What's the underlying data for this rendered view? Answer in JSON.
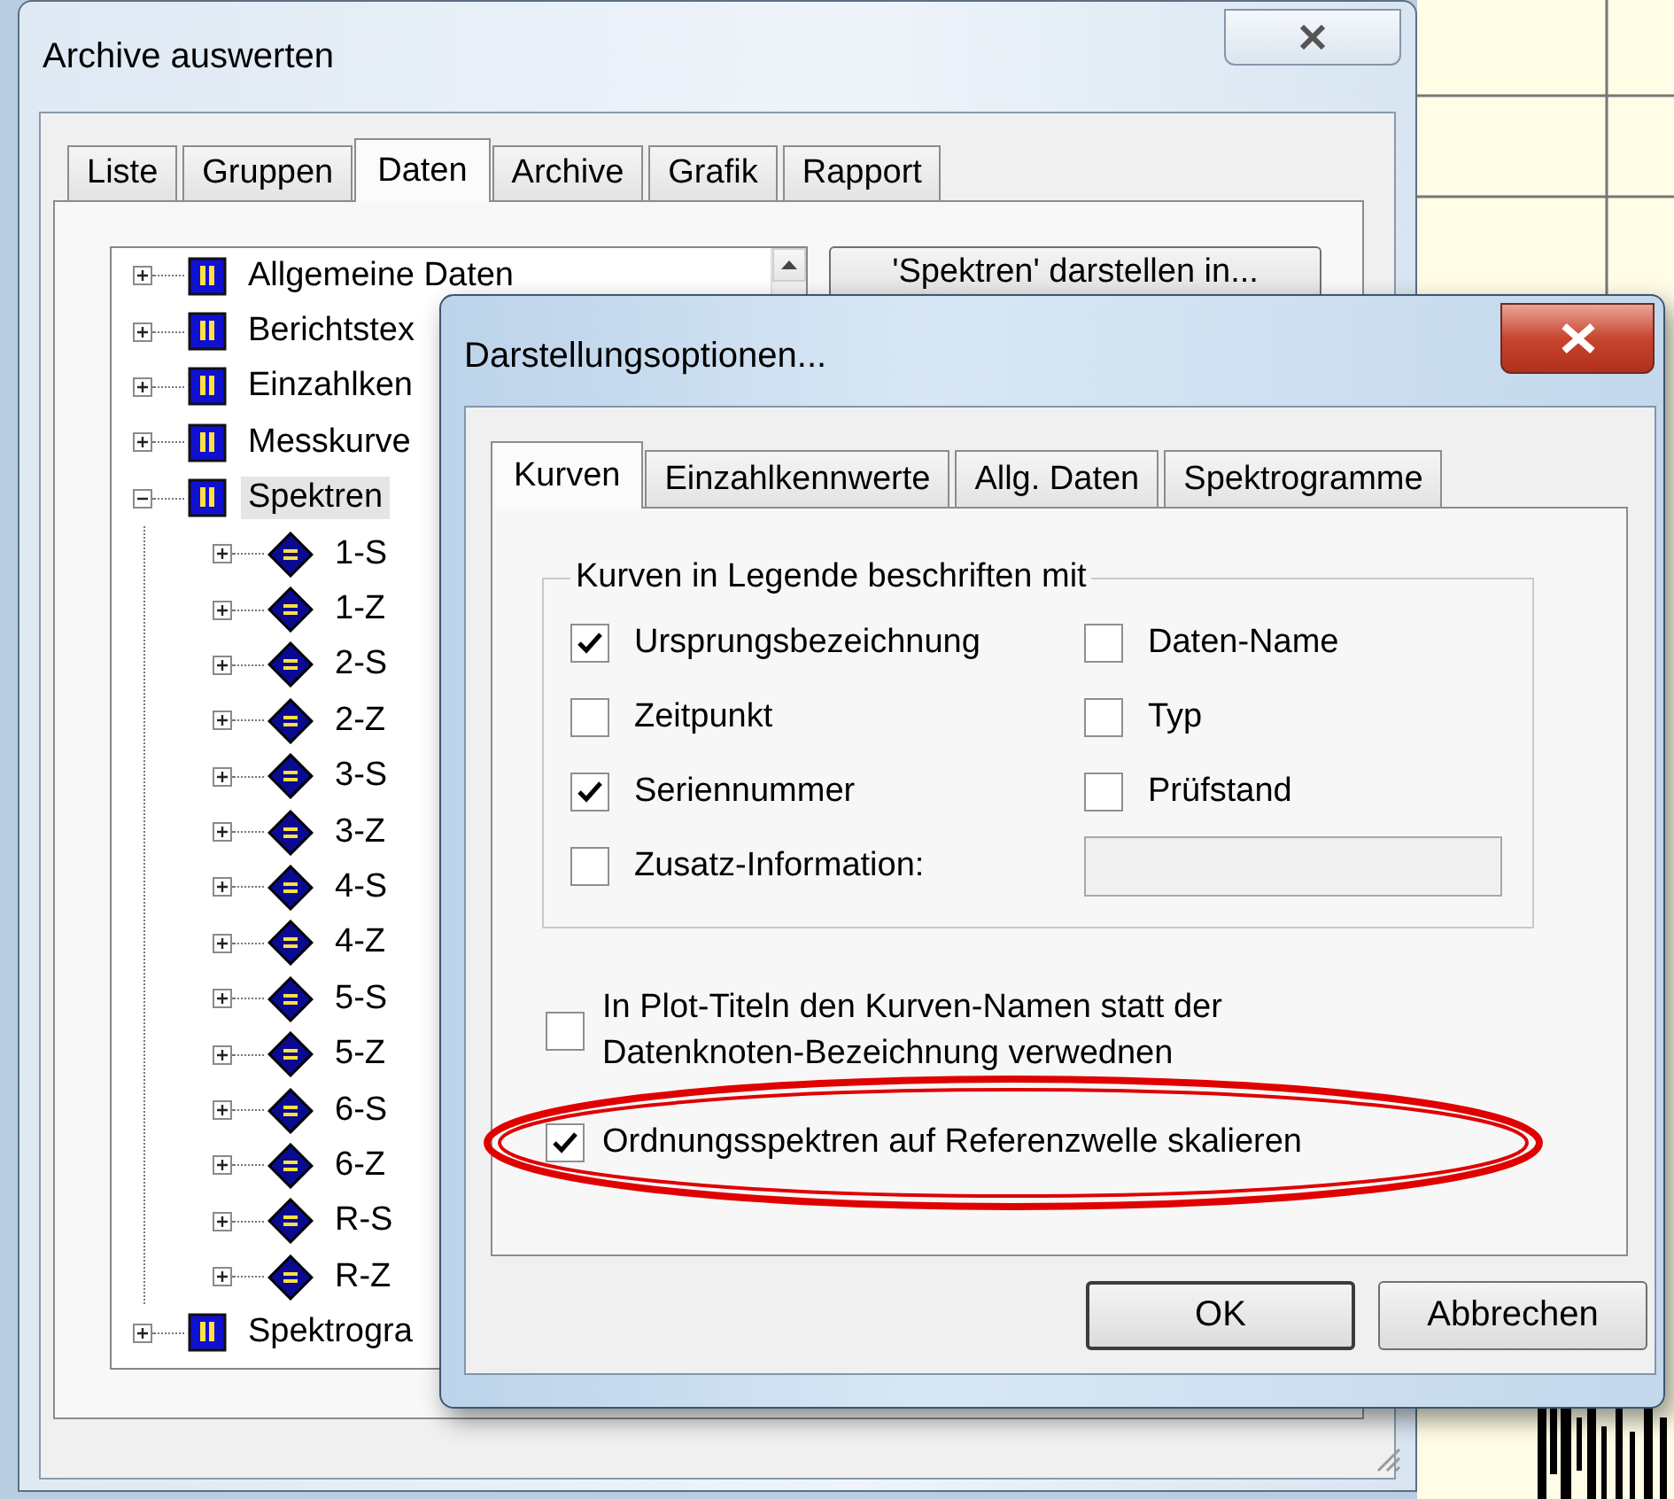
{
  "main_window": {
    "title": "Archive auswerten",
    "tabs": [
      {
        "label": "Liste",
        "selected": false
      },
      {
        "label": "Gruppen",
        "selected": false
      },
      {
        "label": "Daten",
        "selected": true
      },
      {
        "label": "Archive",
        "selected": false
      },
      {
        "label": "Grafik",
        "selected": false
      },
      {
        "label": "Rapport",
        "selected": false
      }
    ],
    "tree": [
      {
        "label": "Allgemeine Daten",
        "kind": "group",
        "expanded": false,
        "selected": false
      },
      {
        "label": "Berichtstex",
        "kind": "group",
        "expanded": false,
        "selected": false
      },
      {
        "label": "Einzahlken",
        "kind": "group",
        "expanded": false,
        "selected": false
      },
      {
        "label": "Messkurve",
        "kind": "group",
        "expanded": false,
        "selected": false
      },
      {
        "label": "Spektren",
        "kind": "group",
        "expanded": true,
        "selected": true,
        "children": [
          {
            "label": "1-S",
            "kind": "series",
            "expanded": false,
            "selected": false
          },
          {
            "label": "1-Z",
            "kind": "series",
            "expanded": false,
            "selected": false
          },
          {
            "label": "2-S",
            "kind": "series",
            "expanded": false,
            "selected": false
          },
          {
            "label": "2-Z",
            "kind": "series",
            "expanded": false,
            "selected": false
          },
          {
            "label": "3-S",
            "kind": "series",
            "expanded": false,
            "selected": false
          },
          {
            "label": "3-Z",
            "kind": "series",
            "expanded": false,
            "selected": false
          },
          {
            "label": "4-S",
            "kind": "series",
            "expanded": false,
            "selected": false
          },
          {
            "label": "4-Z",
            "kind": "series",
            "expanded": false,
            "selected": false
          },
          {
            "label": "5-S",
            "kind": "series",
            "expanded": false,
            "selected": false
          },
          {
            "label": "5-Z",
            "kind": "series",
            "expanded": false,
            "selected": false
          },
          {
            "label": "6-S",
            "kind": "series",
            "expanded": false,
            "selected": false
          },
          {
            "label": "6-Z",
            "kind": "series",
            "expanded": false,
            "selected": false
          },
          {
            "label": "R-S",
            "kind": "series",
            "expanded": false,
            "selected": false
          },
          {
            "label": "R-Z",
            "kind": "series",
            "expanded": false,
            "selected": false
          }
        ]
      },
      {
        "label": "Spektrogra",
        "kind": "group",
        "expanded": false,
        "selected": false
      }
    ],
    "action_button": "'Spektren' darstellen in..."
  },
  "dialog": {
    "title": "Darstellungsoptionen...",
    "tabs": [
      {
        "label": "Kurven",
        "selected": true
      },
      {
        "label": "Einzahlkennwerte",
        "selected": false
      },
      {
        "label": "Allg. Daten",
        "selected": false
      },
      {
        "label": "Spektrogramme",
        "selected": false
      }
    ],
    "group": {
      "title": "Kurven in Legende beschriften mit",
      "options": [
        {
          "kind": "checkbox",
          "label": "Ursprungsbezeichnung",
          "checked": true
        },
        {
          "kind": "checkbox",
          "label": "Daten-Name",
          "checked": false
        },
        {
          "kind": "checkbox",
          "label": "Zeitpunkt",
          "checked": false
        },
        {
          "kind": "checkbox",
          "label": "Typ",
          "checked": false
        },
        {
          "kind": "checkbox",
          "label": "Seriennummer",
          "checked": true
        },
        {
          "kind": "checkbox",
          "label": "Prüfstand",
          "checked": false
        },
        {
          "kind": "checkbox",
          "label": "Zusatz-Information:",
          "checked": false
        },
        {
          "kind": "field",
          "disabled": true
        }
      ]
    },
    "options": [
      {
        "label": "In Plot-Titeln den Kurven-Namen statt der Datenknoten-Bezeichnung verwednen",
        "checked": false
      },
      {
        "label": "Ordnungsspektren auf Referenzwelle skalieren",
        "checked": true
      }
    ],
    "buttons": [
      {
        "label": "OK",
        "default": true
      },
      {
        "label": "Abbrechen",
        "default": false
      }
    ]
  }
}
